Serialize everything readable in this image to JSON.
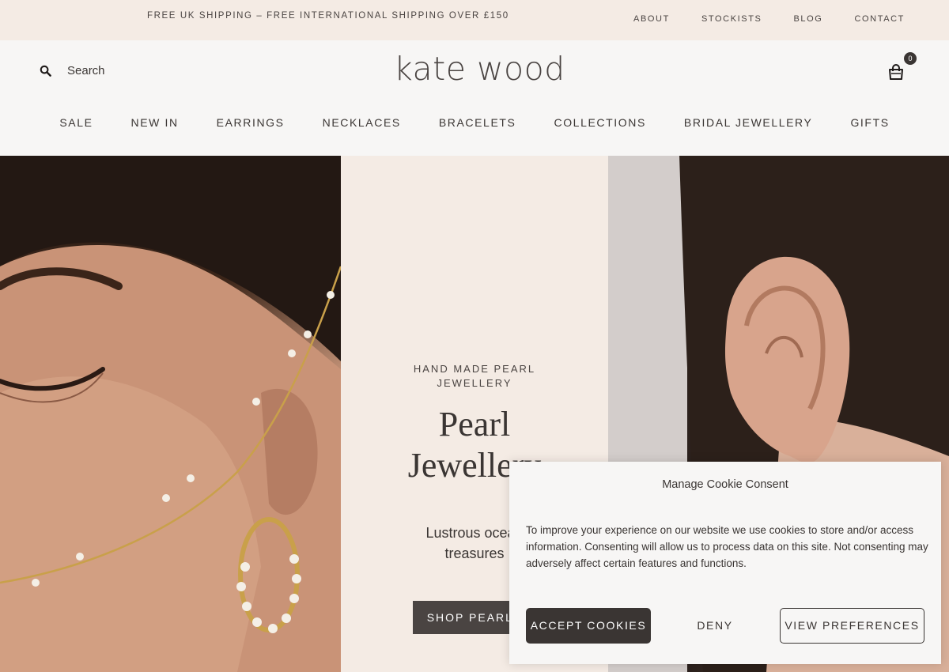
{
  "topbar": {
    "promo": "FREE UK SHIPPING – FREE INTERNATIONAL SHIPPING OVER £150",
    "links": [
      "ABOUT",
      "STOCKISTS",
      "BLOG",
      "CONTACT"
    ]
  },
  "header": {
    "search_placeholder": "Search",
    "logo": "kate wood",
    "cart_count": "0"
  },
  "nav": {
    "items": [
      "SALE",
      "NEW IN",
      "EARRINGS",
      "NECKLACES",
      "BRACELETS",
      "COLLECTIONS",
      "BRIDAL JEWELLERY",
      "GIFTS"
    ]
  },
  "hero": {
    "kicker_line1": "HAND MADE PEARL",
    "kicker_line2": "JEWELLERY",
    "headline_line1": "Pearl",
    "headline_line2": "Jewellery",
    "sub_line1": "Lustrous ocean",
    "sub_line2": "treasures",
    "cta": "SHOP PEARLS"
  },
  "cookie": {
    "title": "Manage Cookie Consent",
    "body": "To improve your experience on our website we use cookies to store and/or access information. Consenting will allow us to process data on this site. Not consenting may adversely affect certain features and functions.",
    "accept": "ACCEPT COOKIES",
    "deny": "DENY",
    "preferences": "VIEW PREFERENCES"
  },
  "icons": {
    "search": "search-icon",
    "cart": "shopping-bag-icon"
  },
  "colors": {
    "topbar_bg": "#f4ebe4",
    "header_bg": "#f7f6f5",
    "text": "#3a3533",
    "button_dark": "#4a4442"
  }
}
